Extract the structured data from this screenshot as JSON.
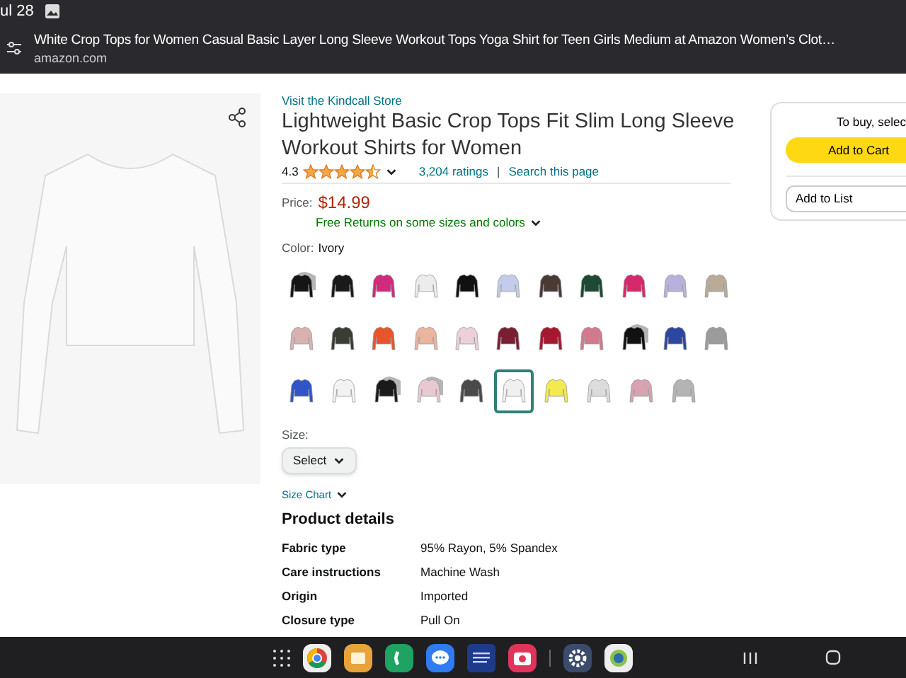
{
  "status_bar": {
    "date": "ul 28"
  },
  "browser_bar": {
    "title": "White Crop Tops for Women Casual Basic Layer Long Sleeve Workout Tops Yoga Shirt for Teen Girls Medium at Amazon Women’s Clot…",
    "domain": "amazon.com"
  },
  "product": {
    "store_link": "Visit the Kindcall Store",
    "title": "Lightweight Basic Crop Tops Fit Slim Long Sleeve Workout Shirts for Women",
    "rating": "4.3",
    "stars": 4.5,
    "ratings_link": "3,204 ratings",
    "separator": "|",
    "search_link": "Search this page",
    "price_label": "Price:",
    "price": "$14.99",
    "returns": "Free Returns on some sizes and colors",
    "color_label": "Color:",
    "color_value": "Ivory",
    "swatches": [
      [
        {
          "kind": "pack",
          "color": "#151515",
          "selected": false
        },
        {
          "kind": "single",
          "color": "#1a1a1a",
          "selected": false
        },
        {
          "kind": "single",
          "color": "#d02b7c",
          "selected": false
        },
        {
          "kind": "single",
          "color": "#ececec",
          "selected": false
        },
        {
          "kind": "single",
          "color": "#111111",
          "selected": false
        },
        {
          "kind": "single",
          "color": "#c5cbea",
          "selected": false
        },
        {
          "kind": "single",
          "color": "#4a3a36",
          "selected": false
        },
        {
          "kind": "single",
          "color": "#1c4a32",
          "selected": false
        },
        {
          "kind": "single",
          "color": "#d42a6b",
          "selected": false
        },
        {
          "kind": "single",
          "color": "#b7b2dc",
          "selected": false
        },
        {
          "kind": "single",
          "color": "#b9ab98",
          "selected": false
        }
      ],
      [
        {
          "kind": "single",
          "color": "#d9b2b0",
          "selected": false
        },
        {
          "kind": "single",
          "color": "#3a3d33",
          "selected": false
        },
        {
          "kind": "single",
          "color": "#e8552a",
          "selected": false
        },
        {
          "kind": "single",
          "color": "#e9b59f",
          "selected": false
        },
        {
          "kind": "single",
          "color": "#ecd0d8",
          "selected": false
        },
        {
          "kind": "single",
          "color": "#7a1f33",
          "selected": false
        },
        {
          "kind": "single",
          "color": "#a5182f",
          "selected": false
        },
        {
          "kind": "single",
          "color": "#d27a8d",
          "selected": false
        },
        {
          "kind": "pack",
          "color": "#111111",
          "selected": false
        },
        {
          "kind": "single",
          "color": "#2d47a0",
          "selected": false
        },
        {
          "kind": "single",
          "color": "#9b9b9b",
          "selected": false
        }
      ],
      [
        {
          "kind": "single",
          "color": "#2f55c8",
          "selected": false
        },
        {
          "kind": "single",
          "color": "#f3f3f3",
          "selected": false
        },
        {
          "kind": "pack",
          "color": "#1a1a1a",
          "selected": false
        },
        {
          "kind": "pack",
          "color": "#e9c9d0",
          "selected": false
        },
        {
          "kind": "single",
          "color": "#4a4a4a",
          "selected": false
        },
        {
          "kind": "single",
          "color": "#f0f0f0",
          "selected": true
        },
        {
          "kind": "single",
          "color": "#f2ea4e",
          "selected": false
        },
        {
          "kind": "single",
          "color": "#dcdcdc",
          "selected": false
        },
        {
          "kind": "single",
          "color": "#d7a3ae",
          "selected": false
        },
        {
          "kind": "single",
          "color": "#b4b4b4",
          "selected": false
        }
      ]
    ],
    "size_label": "Size:",
    "size_select": "Select",
    "size_chart": "Size Chart",
    "details_heading": "Product details",
    "details": [
      {
        "label": "Fabric type",
        "value": "95% Rayon, 5% Spandex"
      },
      {
        "label": "Care instructions",
        "value": "Machine Wash"
      },
      {
        "label": "Origin",
        "value": "Imported"
      },
      {
        "label": "Closure type",
        "value": "Pull On"
      }
    ]
  },
  "buy_box": {
    "prompt": "To buy, selec",
    "cart_button": "Add to Cart",
    "list_button": "Add to List"
  },
  "taskbar": {
    "apps": [
      {
        "kind": "chrome"
      },
      {
        "kind": "files"
      },
      {
        "kind": "phone"
      },
      {
        "kind": "messages"
      },
      {
        "kind": "weather"
      },
      {
        "kind": "camera"
      },
      {
        "kind": "settings"
      },
      {
        "kind": "gallery"
      }
    ]
  }
}
